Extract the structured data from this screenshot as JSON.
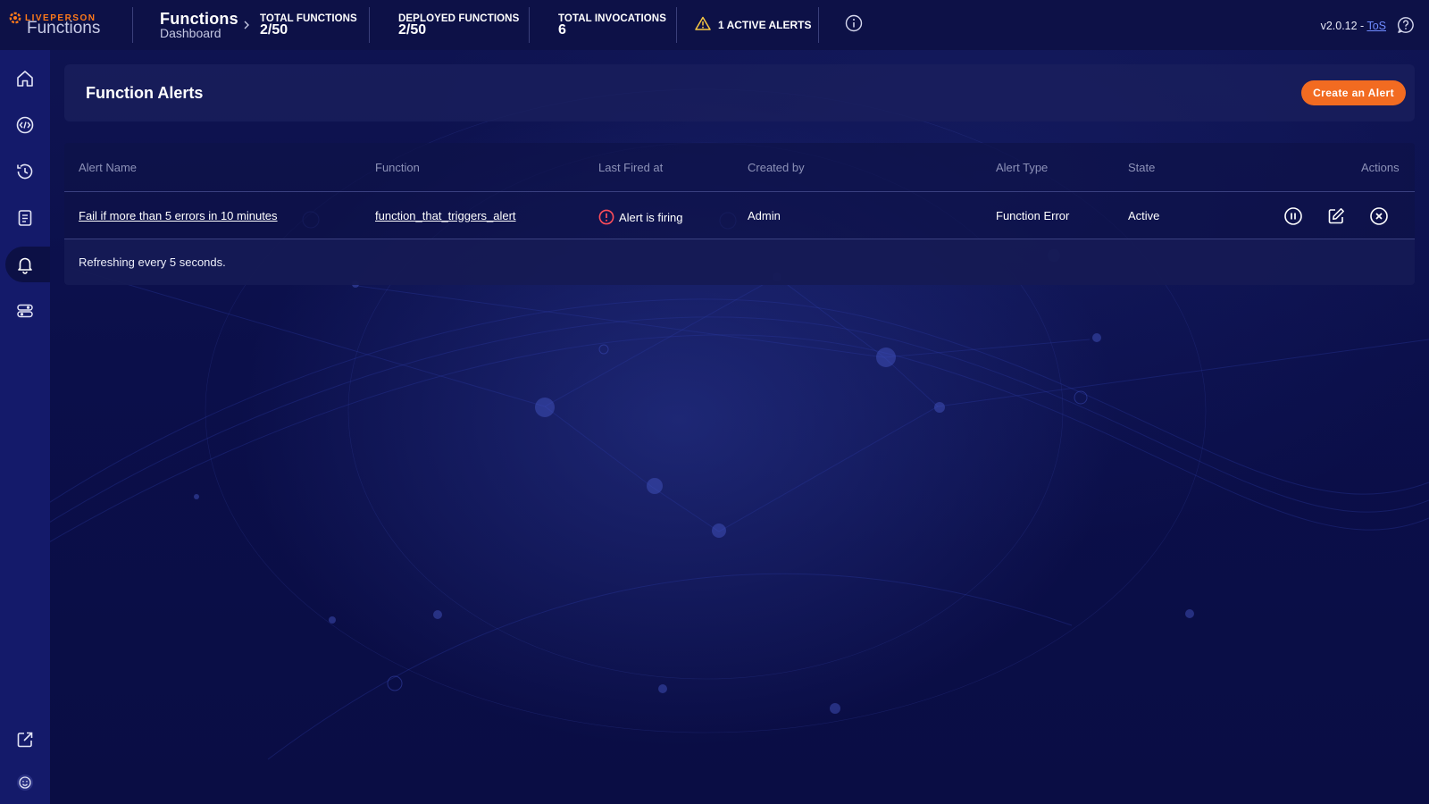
{
  "brand": {
    "company": "LIVEPERSON",
    "product": "Functions"
  },
  "header": {
    "title": "Functions",
    "subtitle": "Dashboard",
    "stats": [
      {
        "label": "TOTAL FUNCTIONS",
        "value": "2/50"
      },
      {
        "label": "DEPLOYED FUNCTIONS",
        "value": "2/50"
      },
      {
        "label": "TOTAL INVOCATIONS",
        "value": "6"
      }
    ],
    "alerts_label": "1 ACTIVE ALERTS",
    "version": "v2.0.12 - ",
    "tos": "ToS"
  },
  "sidebar": {
    "items": [
      {
        "icon": "home-icon",
        "active": false
      },
      {
        "icon": "code-icon",
        "active": false
      },
      {
        "icon": "history-icon",
        "active": false
      },
      {
        "icon": "logs-icon",
        "active": false
      },
      {
        "icon": "bell-icon",
        "active": true
      },
      {
        "icon": "settings-toggle-icon",
        "active": false
      }
    ],
    "bottom": [
      {
        "icon": "external-link-icon"
      },
      {
        "icon": "smiley-icon"
      }
    ]
  },
  "page": {
    "title": "Function Alerts",
    "create_button": "Create an Alert"
  },
  "table": {
    "columns": [
      "Alert Name",
      "Function",
      "Last Fired at",
      "Created by",
      "Alert Type",
      "State",
      "Actions"
    ],
    "rows": [
      {
        "alert_name": "Fail if more than 5 errors in 10 minutes",
        "function": "function_that_triggers_alert",
        "last_fired": "Alert is firing",
        "created_by": "Admin",
        "alert_type": "Function Error",
        "state": "Active",
        "actions": [
          "pause-icon",
          "edit-icon",
          "delete-icon"
        ]
      }
    ],
    "footer": "Refreshing every 5 seconds."
  },
  "colors": {
    "accent": "#f26b21",
    "sidebar": "#141a6a",
    "topbar": "#0d1147",
    "firing": "#ff4d5a",
    "link": "#6f8bff"
  }
}
